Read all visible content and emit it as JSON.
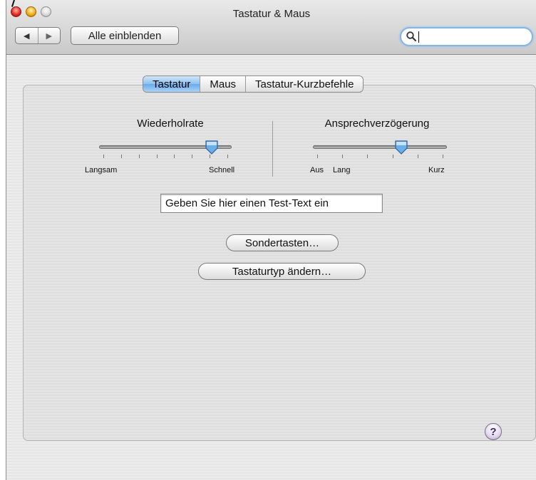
{
  "window": {
    "title": "Tastatur & Maus"
  },
  "toolbar": {
    "back_icon": "◀",
    "forward_icon": "▶",
    "show_all_label": "Alle einblenden",
    "search_value": ""
  },
  "tabs": [
    {
      "label": "Tastatur",
      "active": true
    },
    {
      "label": "Maus",
      "active": false
    },
    {
      "label": "Tastatur-Kurzbefehle",
      "active": false
    }
  ],
  "repeat_rate": {
    "title": "Wiederholrate",
    "left_label": "Langsam",
    "right_label": "Schnell",
    "tick_count": 8,
    "value": 0.85
  },
  "delay": {
    "title": "Ansprechverzögerung",
    "off_label": "Aus",
    "left_label": "Lang",
    "right_label": "Kurz",
    "tick_count": 6,
    "value": 0.66
  },
  "test_field": {
    "value": "Geben Sie hier einen Test-Text ein"
  },
  "buttons": {
    "modifier_keys": "Sondertasten…",
    "change_keyboard_type": "Tastaturtyp ändern…"
  },
  "help_label": "?"
}
